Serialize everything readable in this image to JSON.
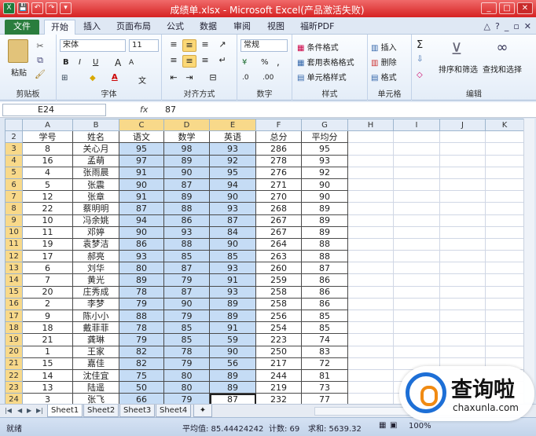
{
  "window": {
    "title": "成绩单.xlsx - Microsoft Excel(产品激活失败)"
  },
  "quick_access": [
    {
      "icon": "excel-logo-icon",
      "text": "X"
    },
    {
      "icon": "save-icon",
      "text": "💾"
    },
    {
      "icon": "undo-icon",
      "text": "↶"
    },
    {
      "icon": "redo-icon",
      "text": "↷"
    },
    {
      "icon": "customize-icon",
      "text": "▾"
    }
  ],
  "tabs": [
    "文件",
    "开始",
    "插入",
    "页面布局",
    "公式",
    "数据",
    "审阅",
    "视图",
    "福昕PDF"
  ],
  "ribbon": {
    "clipboard": {
      "paste": "粘贴",
      "label": "剪贴板"
    },
    "font": {
      "name": "宋体",
      "size": "11",
      "label": "字体",
      "bold": "B",
      "italic": "I",
      "underline": "U",
      "grow": "A",
      "shrink": "A",
      "strike": "abc",
      "font_color": "A",
      "fill_color": "◆",
      "border": "⊞",
      "wen": "文"
    },
    "alignment": {
      "label": "对齐方式"
    },
    "number": {
      "format": "常规",
      "label": "数字",
      "percent": "%",
      "comma": ",",
      "inc": ".0",
      "dec": ".00"
    },
    "styles": {
      "cond": "条件格式",
      "table": "套用表格格式",
      "cell": "单元格样式",
      "label": "样式"
    },
    "cells": {
      "insert": "插入",
      "delete": "删除",
      "format": "格式",
      "label": "单元格"
    },
    "editing": {
      "sigma": "Σ",
      "fill": "⇩",
      "clear": "◇",
      "sort": "排序和筛选",
      "find": "查找和选择",
      "label": "编辑"
    }
  },
  "formula_bar": {
    "name_box": "E24",
    "fx": "fx",
    "value": "87"
  },
  "columns": [
    "A",
    "B",
    "C",
    "D",
    "E",
    "F",
    "G",
    "H",
    "I",
    "J",
    "K"
  ],
  "rows": [
    {
      "n": "2",
      "a": "学号",
      "b": "姓名",
      "c": "语文",
      "d": "数学",
      "e": "英语",
      "f": "总分",
      "g": "平均分"
    },
    {
      "n": "3",
      "a": "8",
      "b": "关心月",
      "c": "95",
      "d": "98",
      "e": "93",
      "f": "286",
      "g": "95"
    },
    {
      "n": "4",
      "a": "16",
      "b": "孟萌",
      "c": "97",
      "d": "89",
      "e": "92",
      "f": "278",
      "g": "93"
    },
    {
      "n": "5",
      "a": "4",
      "b": "张雨晨",
      "c": "91",
      "d": "90",
      "e": "95",
      "f": "276",
      "g": "92"
    },
    {
      "n": "6",
      "a": "5",
      "b": "张震",
      "c": "90",
      "d": "87",
      "e": "94",
      "f": "271",
      "g": "90"
    },
    {
      "n": "7",
      "a": "12",
      "b": "张章",
      "c": "91",
      "d": "89",
      "e": "90",
      "f": "270",
      "g": "90"
    },
    {
      "n": "8",
      "a": "22",
      "b": "蔡明明",
      "c": "87",
      "d": "88",
      "e": "93",
      "f": "268",
      "g": "89"
    },
    {
      "n": "9",
      "a": "10",
      "b": "冯余姚",
      "c": "94",
      "d": "86",
      "e": "87",
      "f": "267",
      "g": "89"
    },
    {
      "n": "10",
      "a": "11",
      "b": "邓婷",
      "c": "90",
      "d": "93",
      "e": "84",
      "f": "267",
      "g": "89"
    },
    {
      "n": "11",
      "a": "19",
      "b": "袁梦洁",
      "c": "86",
      "d": "88",
      "e": "90",
      "f": "264",
      "g": "88"
    },
    {
      "n": "12",
      "a": "17",
      "b": "郝亮",
      "c": "93",
      "d": "85",
      "e": "85",
      "f": "263",
      "g": "88"
    },
    {
      "n": "13",
      "a": "6",
      "b": "刘华",
      "c": "80",
      "d": "87",
      "e": "93",
      "f": "260",
      "g": "87"
    },
    {
      "n": "14",
      "a": "7",
      "b": "黄光",
      "c": "89",
      "d": "79",
      "e": "91",
      "f": "259",
      "g": "86"
    },
    {
      "n": "15",
      "a": "20",
      "b": "庄秀成",
      "c": "78",
      "d": "87",
      "e": "93",
      "f": "258",
      "g": "86"
    },
    {
      "n": "16",
      "a": "2",
      "b": "李梦",
      "c": "79",
      "d": "90",
      "e": "89",
      "f": "258",
      "g": "86"
    },
    {
      "n": "17",
      "a": "9",
      "b": "陈小小",
      "c": "88",
      "d": "79",
      "e": "89",
      "f": "256",
      "g": "85"
    },
    {
      "n": "18",
      "a": "18",
      "b": "戴菲菲",
      "c": "78",
      "d": "85",
      "e": "91",
      "f": "254",
      "g": "85"
    },
    {
      "n": "19",
      "a": "21",
      "b": "龚琳",
      "c": "79",
      "d": "85",
      "e": "59",
      "f": "223",
      "g": "74"
    },
    {
      "n": "20",
      "a": "1",
      "b": "王家",
      "c": "82",
      "d": "78",
      "e": "90",
      "f": "250",
      "g": "83"
    },
    {
      "n": "21",
      "a": "15",
      "b": "嘉佳",
      "c": "82",
      "d": "79",
      "e": "56",
      "f": "217",
      "g": "72"
    },
    {
      "n": "22",
      "a": "14",
      "b": "沈佳宜",
      "c": "75",
      "d": "80",
      "e": "89",
      "f": "244",
      "g": "81"
    },
    {
      "n": "23",
      "a": "13",
      "b": "陆遥",
      "c": "50",
      "d": "80",
      "e": "89",
      "f": "219",
      "g": "73"
    },
    {
      "n": "24",
      "a": "3",
      "b": "张飞",
      "c": "66",
      "d": "79",
      "e": "87",
      "f": "232",
      "g": "77"
    }
  ],
  "sheets": [
    "Sheet1",
    "Sheet2",
    "Sheet3",
    "Sheet4"
  ],
  "status": {
    "ready": "就绪",
    "average": "平均值: 85.44424242",
    "count": "计数: 69",
    "sum": "求和: 5639.32",
    "zoom": "100%"
  },
  "watermark": {
    "text": "查询啦",
    "url": "chaxunla.com"
  },
  "colors": {
    "title_bar": "#e53b3b",
    "file_tab": "#2a7d3d",
    "selection": "#c5dcf5",
    "header_selected": "#f8d98a"
  }
}
